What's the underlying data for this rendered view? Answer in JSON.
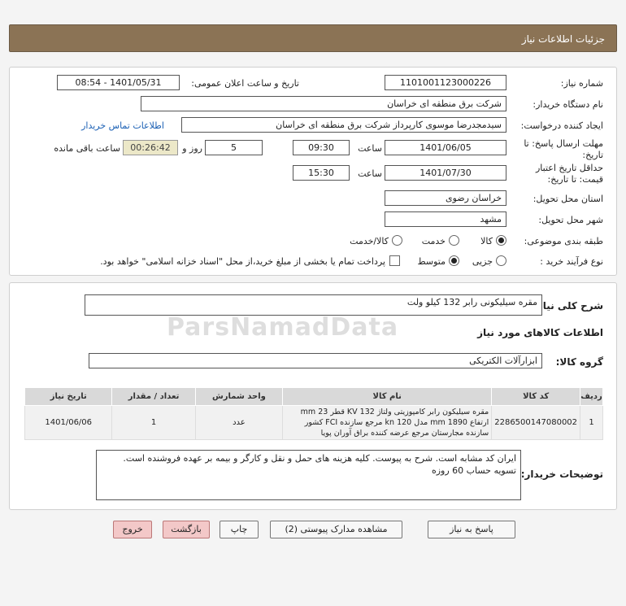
{
  "header": {
    "title": "جزئیات اطلاعات نیاز"
  },
  "form": {
    "need_number_label": "شماره نیاز:",
    "need_number": "1101001123000226",
    "announce_label": "تاریخ و ساعت اعلان عمومی:",
    "announce_value": "1401/05/31 - 08:54",
    "buyer_org_label": "نام دستگاه خریدار:",
    "buyer_org": "شرکت برق منطقه ای خراسان",
    "creator_label": "ایجاد کننده درخواست:",
    "creator": "سیدمجدرضا موسوی کارپرداز شرکت برق منطقه ای خراسان",
    "contact_link": "اطلاعات تماس خریدار",
    "send_deadline_label_1": "مهلت ارسال پاسخ: تا",
    "send_deadline_label_2": "تاریخ:",
    "send_date": "1401/06/05",
    "time_label": "ساعت",
    "send_time": "09:30",
    "days_value": "5",
    "days_label": "روز و",
    "remaining_time": "00:26:42",
    "remaining_label": "ساعت باقی مانده",
    "validity_label_1": "حداقل تاریخ اعتبار",
    "validity_label_2": "قیمت: تا تاریخ:",
    "validity_date": "1401/07/30",
    "validity_time_label": "ساعت",
    "validity_time": "15:30",
    "province_label": "استان محل تحویل:",
    "province": "خراسان رضوی",
    "city_label": "شهر محل تحویل:",
    "city": "مشهد",
    "category_label": "طبقه بندی موضوعی:",
    "category_options": [
      "کالا",
      "خدمت",
      "کالا/خدمت"
    ],
    "process_label": "نوع فرآیند خرید :",
    "process_options": [
      "جزیی",
      "متوسط"
    ],
    "payment_note": "پرداخت تمام یا بخشی از مبلغ خرید،از محل \"اسناد خزانه اسلامی\" خواهد بود."
  },
  "summary": {
    "label": "شرح کلی نیاز:",
    "value": "مقره سیلیکونی رابر  132 کیلو ولت",
    "goods_info_title": "اطلاعات کالاهای مورد نیاز",
    "group_label": "گروه کالا:",
    "group_value": "ابزارآلات الکتریکی",
    "watermark": "ParsNamadData"
  },
  "table": {
    "headers": [
      "ردیف",
      "کد کالا",
      "نام کالا",
      "واحد شمارش",
      "تعداد / مقدار",
      "تاریخ نیاز"
    ],
    "rows": [
      {
        "row": "1",
        "code": "2286500147080002",
        "name": "مقره سیلیکون رابر کامپوزیتی ولتاژ KV 132 قطر mm 23 ارتفاع mm 1890 مدل kn 120 مرجع سازنده FCI کشور سازنده مجارستان مرجع عرضه کننده براق آوران پویا",
        "unit": "عدد",
        "qty": "1",
        "date": "1401/06/06"
      }
    ]
  },
  "notes": {
    "label": "توضیحات خریدار:",
    "value": "ایران کد مشابه است. شرح به پیوست. کلیه هزینه های حمل و نقل و کارگر و بیمه بر عهده فروشنده است. تسویه حساب 60 روزه"
  },
  "buttons": {
    "reply": "پاسخ به نیاز",
    "view_docs": "مشاهده مدارک پیوستی (2)",
    "print": "چاپ",
    "back": "بازگشت",
    "exit": "خروج"
  }
}
